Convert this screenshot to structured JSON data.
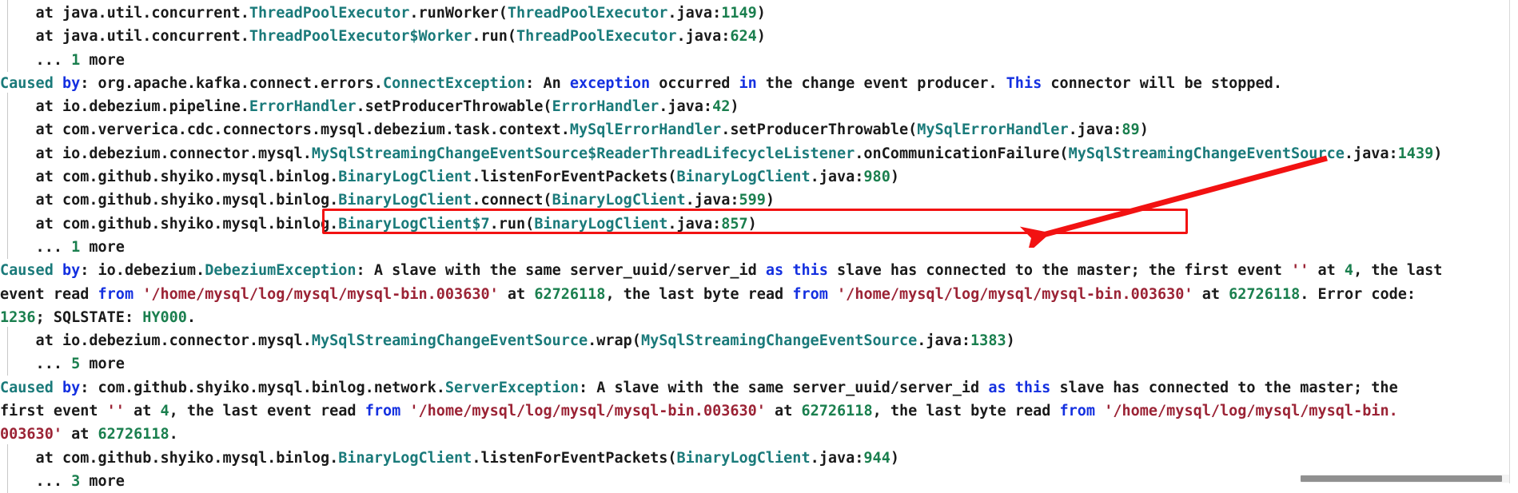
{
  "viewer": {
    "type": "java-stack-trace-log",
    "background_color": "#ffffff",
    "colors": {
      "plain_text": "#1a1a1a",
      "class_name": "#1a7a7a",
      "line_number": "#1a7f4e",
      "keyword": "#1430e0",
      "string_literal": "#9b2335",
      "annotation_red": "#f21212",
      "gutter_guide": "#c8c8c8",
      "scrollbar_thumb": "#909090"
    }
  },
  "annotations": {
    "highlight_box": {
      "name": "red-highlight-rectangle",
      "phrase": "A slave with the same server_uuid/server_id as this slave has connected to the master;",
      "color": "#f21212"
    },
    "arrow": {
      "name": "red-pointer-arrow",
      "points_to": "red-highlight-rectangle",
      "color": "#f21212"
    }
  },
  "scrollbars": {
    "horizontal_label": "horizontal-scrollbar",
    "vertical_label": "vertical-scrollbar"
  },
  "log": {
    "lines": [
      {
        "id": 0,
        "indented": true,
        "plain": "    at java.util.concurrent.ThreadPoolExecutor.runWorker(ThreadPoolExecutor.java:1149)",
        "tokens": [
          {
            "t": "    at java.util.concurrent.",
            "c": "plain"
          },
          {
            "t": "ThreadPoolExecutor",
            "c": "teal"
          },
          {
            "t": ".runWorker(",
            "c": "plain"
          },
          {
            "t": "ThreadPoolExecutor",
            "c": "teal"
          },
          {
            "t": ".java:",
            "c": "plain"
          },
          {
            "t": "1149",
            "c": "green"
          },
          {
            "t": ")",
            "c": "plain"
          }
        ]
      },
      {
        "id": 1,
        "indented": true,
        "plain": "    at java.util.concurrent.ThreadPoolExecutor$Worker.run(ThreadPoolExecutor.java:624)",
        "tokens": [
          {
            "t": "    at java.util.concurrent.",
            "c": "plain"
          },
          {
            "t": "ThreadPoolExecutor$Worker",
            "c": "teal"
          },
          {
            "t": ".run(",
            "c": "plain"
          },
          {
            "t": "ThreadPoolExecutor",
            "c": "teal"
          },
          {
            "t": ".java:",
            "c": "plain"
          },
          {
            "t": "624",
            "c": "green"
          },
          {
            "t": ")",
            "c": "plain"
          }
        ]
      },
      {
        "id": 2,
        "indented": true,
        "plain": "    ... 1 more",
        "tokens": [
          {
            "t": "    ... ",
            "c": "plain"
          },
          {
            "t": "1",
            "c": "green"
          },
          {
            "t": " more",
            "c": "plain"
          }
        ]
      },
      {
        "id": 3,
        "indented": false,
        "plain": "Caused by: org.apache.kafka.connect.errors.ConnectException: An exception occurred in the change event producer. This connector will be stopped.",
        "tokens": [
          {
            "t": "Caused",
            "c": "causedby"
          },
          {
            "t": " ",
            "c": "plain"
          },
          {
            "t": "by",
            "c": "blue"
          },
          {
            "t": ": org.apache.kafka.connect.errors.",
            "c": "plain"
          },
          {
            "t": "ConnectException",
            "c": "teal"
          },
          {
            "t": ": An ",
            "c": "plain"
          },
          {
            "t": "exception",
            "c": "blue"
          },
          {
            "t": " occurred ",
            "c": "plain"
          },
          {
            "t": "in",
            "c": "blue"
          },
          {
            "t": " the change event producer. ",
            "c": "plain"
          },
          {
            "t": "This",
            "c": "blue"
          },
          {
            "t": " connector will be stopped.",
            "c": "plain"
          }
        ]
      },
      {
        "id": 4,
        "indented": true,
        "plain": "    at io.debezium.pipeline.ErrorHandler.setProducerThrowable(ErrorHandler.java:42)",
        "tokens": [
          {
            "t": "    at io.debezium.pipeline.",
            "c": "plain"
          },
          {
            "t": "ErrorHandler",
            "c": "teal"
          },
          {
            "t": ".setProducerThrowable(",
            "c": "plain"
          },
          {
            "t": "ErrorHandler",
            "c": "teal"
          },
          {
            "t": ".java:",
            "c": "plain"
          },
          {
            "t": "42",
            "c": "green"
          },
          {
            "t": ")",
            "c": "plain"
          }
        ]
      },
      {
        "id": 5,
        "indented": true,
        "plain": "    at com.ververica.cdc.connectors.mysql.debezium.task.context.MySqlErrorHandler.setProducerThrowable(MySqlErrorHandler.java:89)",
        "tokens": [
          {
            "t": "    at com.ververica.cdc.connectors.mysql.debezium.task.context.",
            "c": "plain"
          },
          {
            "t": "MySqlErrorHandler",
            "c": "teal"
          },
          {
            "t": ".setProducerThrowable(",
            "c": "plain"
          },
          {
            "t": "MySqlErrorHandler",
            "c": "teal"
          },
          {
            "t": ".java:",
            "c": "plain"
          },
          {
            "t": "89",
            "c": "green"
          },
          {
            "t": ")",
            "c": "plain"
          }
        ]
      },
      {
        "id": 6,
        "indented": true,
        "plain": "    at io.debezium.connector.mysql.MySqlStreamingChangeEventSource$ReaderThreadLifecycleListener.onCommunicationFailure(MySqlStreamingChangeEventSource.java:1439)",
        "tokens": [
          {
            "t": "    at io.debezium.connector.mysql.",
            "c": "plain"
          },
          {
            "t": "MySqlStreamingChangeEventSource$ReaderThreadLifecycleListener",
            "c": "teal"
          },
          {
            "t": ".onCommunicationFailure(",
            "c": "plain"
          },
          {
            "t": "MySqlStreamingChangeEventSource",
            "c": "teal"
          },
          {
            "t": ".java:",
            "c": "plain"
          },
          {
            "t": "1439",
            "c": "green"
          },
          {
            "t": ")",
            "c": "plain"
          }
        ]
      },
      {
        "id": 7,
        "indented": true,
        "plain": "    at com.github.shyiko.mysql.binlog.BinaryLogClient.listenForEventPackets(BinaryLogClient.java:980)",
        "tokens": [
          {
            "t": "    at com.github.shyiko.mysql.binlog.",
            "c": "plain"
          },
          {
            "t": "BinaryLogClient",
            "c": "teal"
          },
          {
            "t": ".listenForEventPackets(",
            "c": "plain"
          },
          {
            "t": "BinaryLogClient",
            "c": "teal"
          },
          {
            "t": ".java:",
            "c": "plain"
          },
          {
            "t": "980",
            "c": "green"
          },
          {
            "t": ")",
            "c": "plain"
          }
        ]
      },
      {
        "id": 8,
        "indented": true,
        "plain": "    at com.github.shyiko.mysql.binlog.BinaryLogClient.connect(BinaryLogClient.java:599)",
        "tokens": [
          {
            "t": "    at com.github.shyiko.mysql.binlog.",
            "c": "plain"
          },
          {
            "t": "BinaryLogClient",
            "c": "teal"
          },
          {
            "t": ".connect(",
            "c": "plain"
          },
          {
            "t": "BinaryLogClient",
            "c": "teal"
          },
          {
            "t": ".java:",
            "c": "plain"
          },
          {
            "t": "599",
            "c": "green"
          },
          {
            "t": ")",
            "c": "plain"
          }
        ]
      },
      {
        "id": 9,
        "indented": true,
        "plain": "    at com.github.shyiko.mysql.binlog.BinaryLogClient$7.run(BinaryLogClient.java:857)",
        "tokens": [
          {
            "t": "    at com.github.shyiko.mysql.binlog.",
            "c": "plain"
          },
          {
            "t": "BinaryLogClient$7",
            "c": "teal"
          },
          {
            "t": ".run(",
            "c": "plain"
          },
          {
            "t": "BinaryLogClient",
            "c": "teal"
          },
          {
            "t": ".java:",
            "c": "plain"
          },
          {
            "t": "857",
            "c": "green"
          },
          {
            "t": ")",
            "c": "plain"
          }
        ]
      },
      {
        "id": 10,
        "indented": true,
        "plain": "    ... 1 more",
        "tokens": [
          {
            "t": "    ... ",
            "c": "plain"
          },
          {
            "t": "1",
            "c": "green"
          },
          {
            "t": " more",
            "c": "plain"
          }
        ]
      },
      {
        "id": 11,
        "indented": false,
        "plain": "Caused by: io.debezium.DebeziumException: A slave with the same server_uuid/server_id as this slave has connected to the master; the first event '' at 4, the last",
        "tokens": [
          {
            "t": "Caused",
            "c": "causedby"
          },
          {
            "t": " ",
            "c": "plain"
          },
          {
            "t": "by",
            "c": "blue"
          },
          {
            "t": ": io.debezium.",
            "c": "plain"
          },
          {
            "t": "DebeziumException",
            "c": "teal"
          },
          {
            "t": ": A slave with the same server_uuid/server_id ",
            "c": "plain"
          },
          {
            "t": "as",
            "c": "blue"
          },
          {
            "t": " ",
            "c": "plain"
          },
          {
            "t": "this",
            "c": "blue"
          },
          {
            "t": " slave has connected to the master; the first event ",
            "c": "plain"
          },
          {
            "t": "''",
            "c": "darkred"
          },
          {
            "t": " at ",
            "c": "plain"
          },
          {
            "t": "4",
            "c": "green"
          },
          {
            "t": ", the last",
            "c": "plain"
          }
        ]
      },
      {
        "id": 12,
        "indented": false,
        "plain": "event read from '/home/mysql/log/mysql/mysql-bin.003630' at 62726118, the last byte read from '/home/mysql/log/mysql/mysql-bin.003630' at 62726118. Error code:",
        "tokens": [
          {
            "t": "event read ",
            "c": "plain"
          },
          {
            "t": "from",
            "c": "blue"
          },
          {
            "t": " ",
            "c": "plain"
          },
          {
            "t": "'/home/mysql/log/mysql/mysql-bin.003630'",
            "c": "darkred"
          },
          {
            "t": " at ",
            "c": "plain"
          },
          {
            "t": "62726118",
            "c": "green"
          },
          {
            "t": ", the last byte read ",
            "c": "plain"
          },
          {
            "t": "from",
            "c": "blue"
          },
          {
            "t": " ",
            "c": "plain"
          },
          {
            "t": "'/home/mysql/log/mysql/mysql-bin.003630'",
            "c": "darkred"
          },
          {
            "t": " at ",
            "c": "plain"
          },
          {
            "t": "62726118",
            "c": "green"
          },
          {
            "t": ". Error code:",
            "c": "plain"
          }
        ]
      },
      {
        "id": 13,
        "indented": false,
        "plain": "1236; SQLSTATE: HY000.",
        "tokens": [
          {
            "t": "1236",
            "c": "green"
          },
          {
            "t": "; SQLSTATE: ",
            "c": "plain"
          },
          {
            "t": "HY000",
            "c": "green"
          },
          {
            "t": ".",
            "c": "plain"
          }
        ]
      },
      {
        "id": 14,
        "indented": true,
        "plain": "    at io.debezium.connector.mysql.MySqlStreamingChangeEventSource.wrap(MySqlStreamingChangeEventSource.java:1383)",
        "tokens": [
          {
            "t": "    at io.debezium.connector.mysql.",
            "c": "plain"
          },
          {
            "t": "MySqlStreamingChangeEventSource",
            "c": "teal"
          },
          {
            "t": ".wrap(",
            "c": "plain"
          },
          {
            "t": "MySqlStreamingChangeEventSource",
            "c": "teal"
          },
          {
            "t": ".java:",
            "c": "plain"
          },
          {
            "t": "1383",
            "c": "green"
          },
          {
            "t": ")",
            "c": "plain"
          }
        ]
      },
      {
        "id": 15,
        "indented": true,
        "plain": "    ... 5 more",
        "tokens": [
          {
            "t": "    ... ",
            "c": "plain"
          },
          {
            "t": "5",
            "c": "green"
          },
          {
            "t": " more",
            "c": "plain"
          }
        ]
      },
      {
        "id": 16,
        "indented": false,
        "plain": "Caused by: com.github.shyiko.mysql.binlog.network.ServerException: A slave with the same server_uuid/server_id as this slave has connected to the master; the",
        "tokens": [
          {
            "t": "Caused",
            "c": "causedby"
          },
          {
            "t": " ",
            "c": "plain"
          },
          {
            "t": "by",
            "c": "blue"
          },
          {
            "t": ": com.github.shyiko.mysql.binlog.network.",
            "c": "plain"
          },
          {
            "t": "ServerException",
            "c": "teal"
          },
          {
            "t": ": A slave with the same server_uuid/server_id ",
            "c": "plain"
          },
          {
            "t": "as",
            "c": "blue"
          },
          {
            "t": " ",
            "c": "plain"
          },
          {
            "t": "this",
            "c": "blue"
          },
          {
            "t": " slave has connected to the master; the",
            "c": "plain"
          }
        ]
      },
      {
        "id": 17,
        "indented": false,
        "plain": "first event '' at 4, the last event read from '/home/mysql/log/mysql/mysql-bin.003630' at 62726118, the last byte read from '/home/mysql/log/mysql/mysql-bin.",
        "tokens": [
          {
            "t": "first event ",
            "c": "plain"
          },
          {
            "t": "''",
            "c": "darkred"
          },
          {
            "t": " at ",
            "c": "plain"
          },
          {
            "t": "4",
            "c": "green"
          },
          {
            "t": ", the last event read ",
            "c": "plain"
          },
          {
            "t": "from",
            "c": "blue"
          },
          {
            "t": " ",
            "c": "plain"
          },
          {
            "t": "'/home/mysql/log/mysql/mysql-bin.003630'",
            "c": "darkred"
          },
          {
            "t": " at ",
            "c": "plain"
          },
          {
            "t": "62726118",
            "c": "green"
          },
          {
            "t": ", the last byte read ",
            "c": "plain"
          },
          {
            "t": "from",
            "c": "blue"
          },
          {
            "t": " ",
            "c": "plain"
          },
          {
            "t": "'/home/mysql/log/mysql/mysql-bin.",
            "c": "darkred"
          }
        ]
      },
      {
        "id": 18,
        "indented": false,
        "plain": "003630' at 62726118.",
        "tokens": [
          {
            "t": "003630'",
            "c": "darkred"
          },
          {
            "t": " at ",
            "c": "plain"
          },
          {
            "t": "62726118",
            "c": "green"
          },
          {
            "t": ".",
            "c": "plain"
          }
        ]
      },
      {
        "id": 19,
        "indented": true,
        "plain": "    at com.github.shyiko.mysql.binlog.BinaryLogClient.listenForEventPackets(BinaryLogClient.java:944)",
        "tokens": [
          {
            "t": "    at com.github.shyiko.mysql.binlog.",
            "c": "plain"
          },
          {
            "t": "BinaryLogClient",
            "c": "teal"
          },
          {
            "t": ".listenForEventPackets(",
            "c": "plain"
          },
          {
            "t": "BinaryLogClient",
            "c": "teal"
          },
          {
            "t": ".java:",
            "c": "plain"
          },
          {
            "t": "944",
            "c": "green"
          },
          {
            "t": ")",
            "c": "plain"
          }
        ]
      },
      {
        "id": 20,
        "indented": true,
        "plain": "    ... 3 more",
        "tokens": [
          {
            "t": "    ... ",
            "c": "plain"
          },
          {
            "t": "3",
            "c": "green"
          },
          {
            "t": " more",
            "c": "plain"
          }
        ]
      }
    ]
  }
}
